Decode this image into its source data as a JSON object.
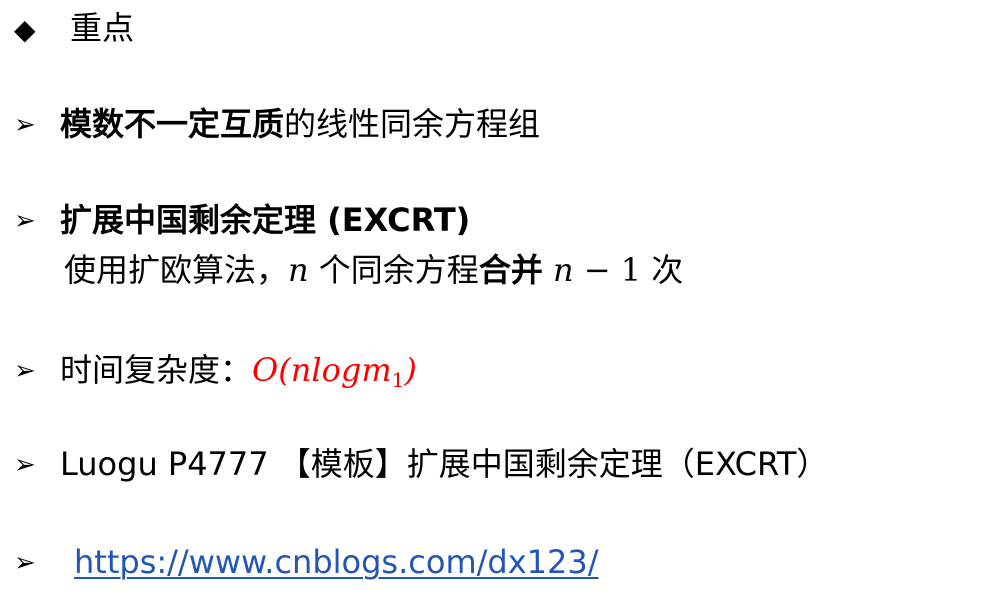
{
  "heading": {
    "bullet": "◆",
    "title": "重点"
  },
  "bullet_glyph": "➢",
  "items": [
    {
      "bold": "模数不一定互质",
      "rest": "的线性同余方程组"
    },
    {
      "bold": "扩展中国剩余定理 (EXCRT)",
      "line2_prefix": "使用扩欧算法，",
      "line2_var": "n",
      "line2_mid": " 个同余方程",
      "line2_bold": "合并",
      "line2_expr_var": "n",
      "line2_expr_rest": " − 1",
      "line2_suffix": " 次"
    },
    {
      "label": "时间复杂度：",
      "formula_main": "O(nlogm",
      "formula_sub": "1",
      "formula_close": ")"
    },
    {
      "text": "Luogu P4777 【模板】扩展中国剩余定理（EXCRT）"
    },
    {
      "link": "https://www.cnblogs.com/dx123/"
    }
  ],
  "colors": {
    "accent_red": "#ff0000",
    "link_blue": "#2155b6"
  }
}
